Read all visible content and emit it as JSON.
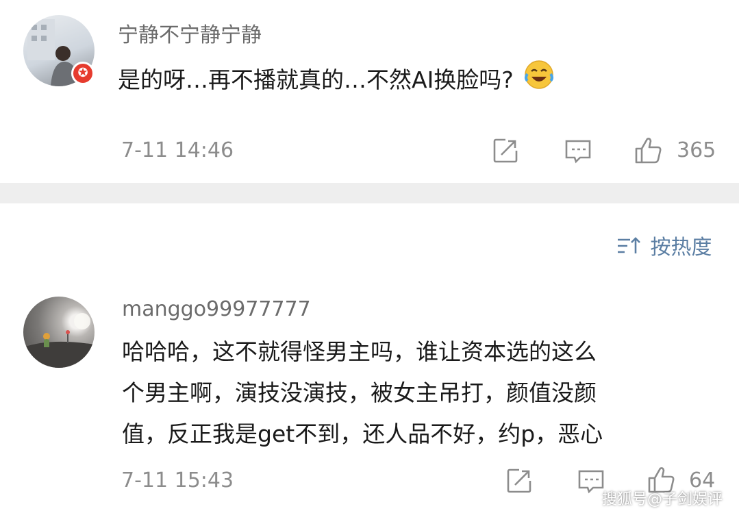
{
  "comments": [
    {
      "username": "宁静不宁静宁静",
      "text_lines": [
        "是的呀…再不播就真的…不然AI换脸吗?"
      ],
      "emoji": "laughing-crying-emoji",
      "time": "7-11 14:46",
      "likes": "365"
    },
    {
      "username": "manggo99977777",
      "text_lines": [
        "哈哈哈，这不就得怪男主吗，谁让资本选的这么",
        "个男主啊，演技没演技，被女主吊打，颜值没颜",
        "值，反正我是get不到，还人品不好，约p，恶心"
      ],
      "time": "7-11 15:43",
      "likes": "64"
    }
  ],
  "sort": {
    "label": "按热度",
    "icon": "sort-icon"
  },
  "badge_glyph": "✪",
  "watermark": "搜狐号@子剑娱评",
  "colors": {
    "divider": "#eeeeee",
    "sort_text": "#5b7ea3",
    "meta_text": "#8c8c8c",
    "badge": "#e63b2e"
  }
}
